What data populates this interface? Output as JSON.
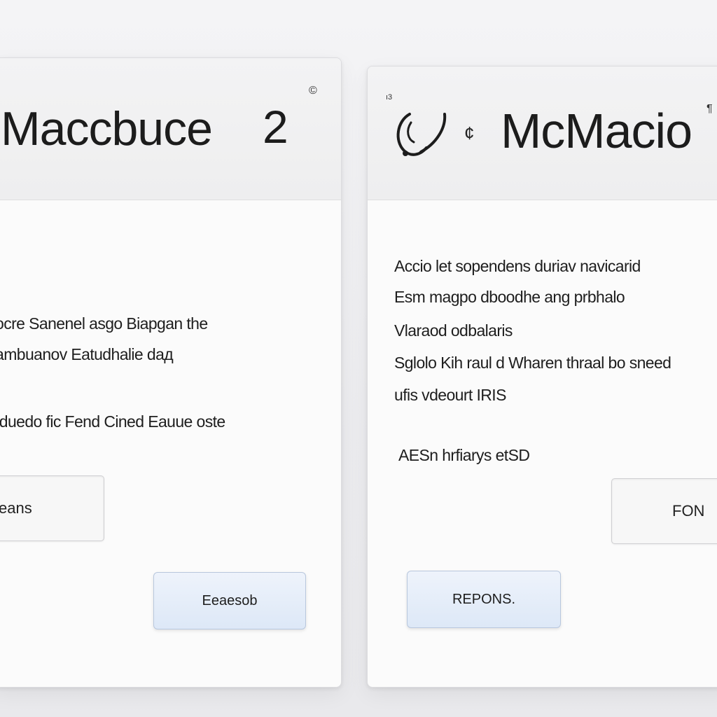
{
  "left_panel": {
    "title": "Maccbuce",
    "title_number": "2",
    "corner_glyph": "©",
    "body_lines": [
      "ocre Sanenel asgo Biapgan the",
      "ambuanov Eatudhalie daд",
      "Iduedo fic Fend Cined Eauue oste"
    ],
    "field_value": "eans",
    "button_label": "Eeaesob"
  },
  "right_panel": {
    "title": "McMacio",
    "corner_glyph": "ı3",
    "bell_glyph": "¶",
    "logo_small": "¢",
    "body_lines": [
      "Accio let sopendens duriav navicarid",
      "Esm magpo dboodhe ang prbhalo",
      "Vlaraod odbalaris",
      "Sglolo Kih raul d Wharen thraal bo sneed",
      "ufis vdeourt IRIS",
      "AESn hrfiarys etSD"
    ],
    "field_value": "FON",
    "button_label": "REPONS."
  },
  "colors": {
    "button_gradient_top": "#eef3fb",
    "button_gradient_bottom": "#dde8f7",
    "panel_background": "#fbfbfb",
    "header_background": "#f0f0f1"
  }
}
